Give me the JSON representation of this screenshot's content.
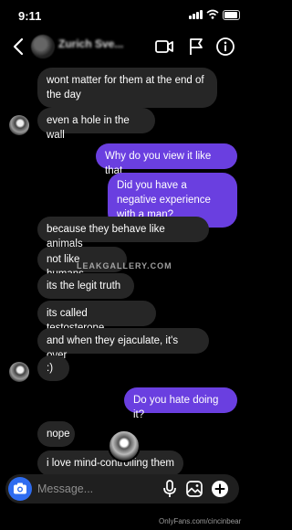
{
  "status_bar": {
    "time": "9:11"
  },
  "header": {
    "name": "Zurich Sve...",
    "subtitle": ""
  },
  "messages": [
    {
      "side": "in",
      "text": "wont matter for them at the end of the day"
    },
    {
      "side": "in",
      "text": "even a hole in the wall"
    },
    {
      "side": "out",
      "text": "Why do you view it like that"
    },
    {
      "side": "out",
      "text": "Did you have a negative experience with a man?"
    },
    {
      "side": "in",
      "text": "because they behave like animals"
    },
    {
      "side": "in",
      "text": "not like humans"
    },
    {
      "side": "in",
      "text": "its the legit truth"
    },
    {
      "side": "in",
      "text": "its called testosterone"
    },
    {
      "side": "in",
      "text": "and when they ejaculate, it's over"
    },
    {
      "side": "in",
      "text": ":)"
    },
    {
      "side": "out",
      "text": "Do you hate doing it?"
    },
    {
      "side": "in",
      "text": "nope"
    },
    {
      "side": "in",
      "text": "i love mind-controlling them"
    }
  ],
  "watermark": "LEAKGALLERY.COM",
  "composer": {
    "placeholder": "Message..."
  },
  "footer": "OnlyFans.com/cincinbear",
  "colors": {
    "outgoing_bubble": "#6a3fe0",
    "incoming_bubble": "#262626",
    "camera_button": "#2e6cf0"
  },
  "icons": [
    "back-icon",
    "video-call-icon",
    "flag-icon",
    "info-icon",
    "camera-icon",
    "microphone-icon",
    "gallery-icon",
    "plus-icon"
  ]
}
